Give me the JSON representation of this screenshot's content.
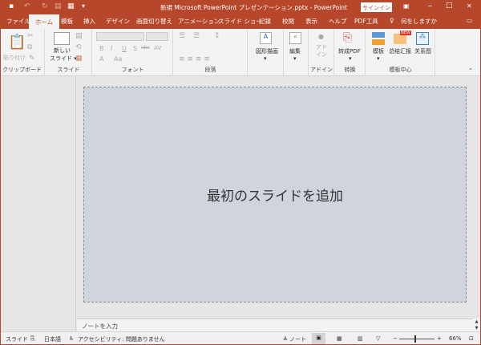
{
  "titlebar": {
    "title": "新規 Microsoft PowerPoint プレゼンテーション.pptx  -  PowerPoint",
    "signin": "サインイン",
    "minimize": "−",
    "maximize": "□",
    "close": "✕",
    "ribbon_display": "▣"
  },
  "qat": {
    "save": "💾",
    "undo": "↶",
    "redo": "↻",
    "dropdown": "▾"
  },
  "tabs": [
    "ファイル",
    "ホーム",
    "模板",
    "挿入",
    "デザイン",
    "画面切り替え",
    "アニメーション",
    "スライド ショー",
    "記録",
    "校閲",
    "表示",
    "ヘルプ",
    "PDF工具"
  ],
  "tell_me": "何をしますか",
  "ribbon": {
    "clipboard": {
      "label": "クリップボード",
      "paste": "貼り付け"
    },
    "slides": {
      "label": "スライド",
      "new_slide_1": "新しい",
      "new_slide_2": "スライド ▾"
    },
    "font": {
      "label": "フォント",
      "bold": "B",
      "italic": "I",
      "underline": "U",
      "shadow": "S",
      "strike": "abc",
      "spacing": "AV",
      "size_up": "A",
      "case": "Aa"
    },
    "paragraph": {
      "label": "段落"
    },
    "drawing": {
      "label": "図形描画"
    },
    "editing": {
      "label": "編集"
    },
    "addin": {
      "label": "アドイン",
      "button": "アド\nイン"
    },
    "convert": {
      "label": "转换",
      "button": "转成PDF"
    },
    "template": {
      "label": "模板中心",
      "t1": "模板",
      "t2": "总结汇报",
      "t3": "关系图",
      "badge": "NEW"
    }
  },
  "slide": {
    "placeholder": "最初のスライドを追加"
  },
  "notes": {
    "placeholder": "ノートを入力"
  },
  "status": {
    "slide": "スライド",
    "language": "日本語",
    "accessibility": "アクセシビリティ: 問題ありません",
    "notes": "ノート",
    "zoom": "66%",
    "zoom_percent": 66
  },
  "colors": {
    "accent": "#b7472a",
    "slide_bg": "#d0d4dc"
  }
}
